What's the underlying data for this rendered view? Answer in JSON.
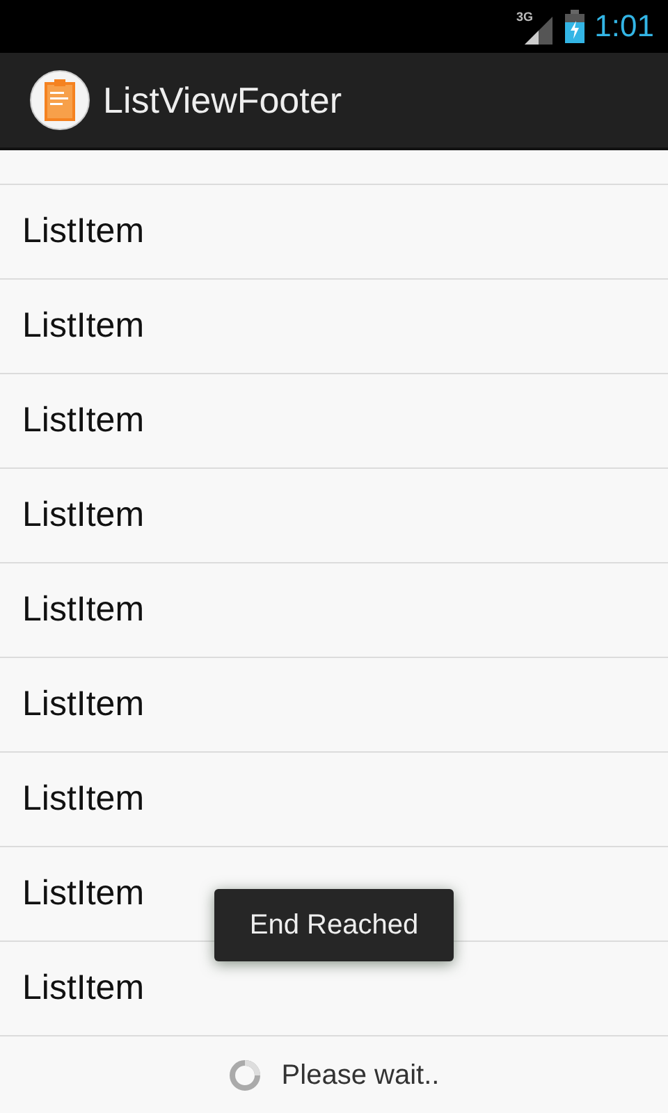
{
  "status_bar": {
    "network": "3G",
    "time": "1:01"
  },
  "action_bar": {
    "title": "ListViewFooter"
  },
  "list": {
    "items": [
      {
        "label": "ListItem"
      },
      {
        "label": "ListItem"
      },
      {
        "label": "ListItem"
      },
      {
        "label": "ListItem"
      },
      {
        "label": "ListItem"
      },
      {
        "label": "ListItem"
      },
      {
        "label": "ListItem"
      },
      {
        "label": "ListItem"
      },
      {
        "label": "ListItem"
      }
    ]
  },
  "footer": {
    "text": "Please wait.."
  },
  "toast": {
    "text": "End Reached"
  }
}
